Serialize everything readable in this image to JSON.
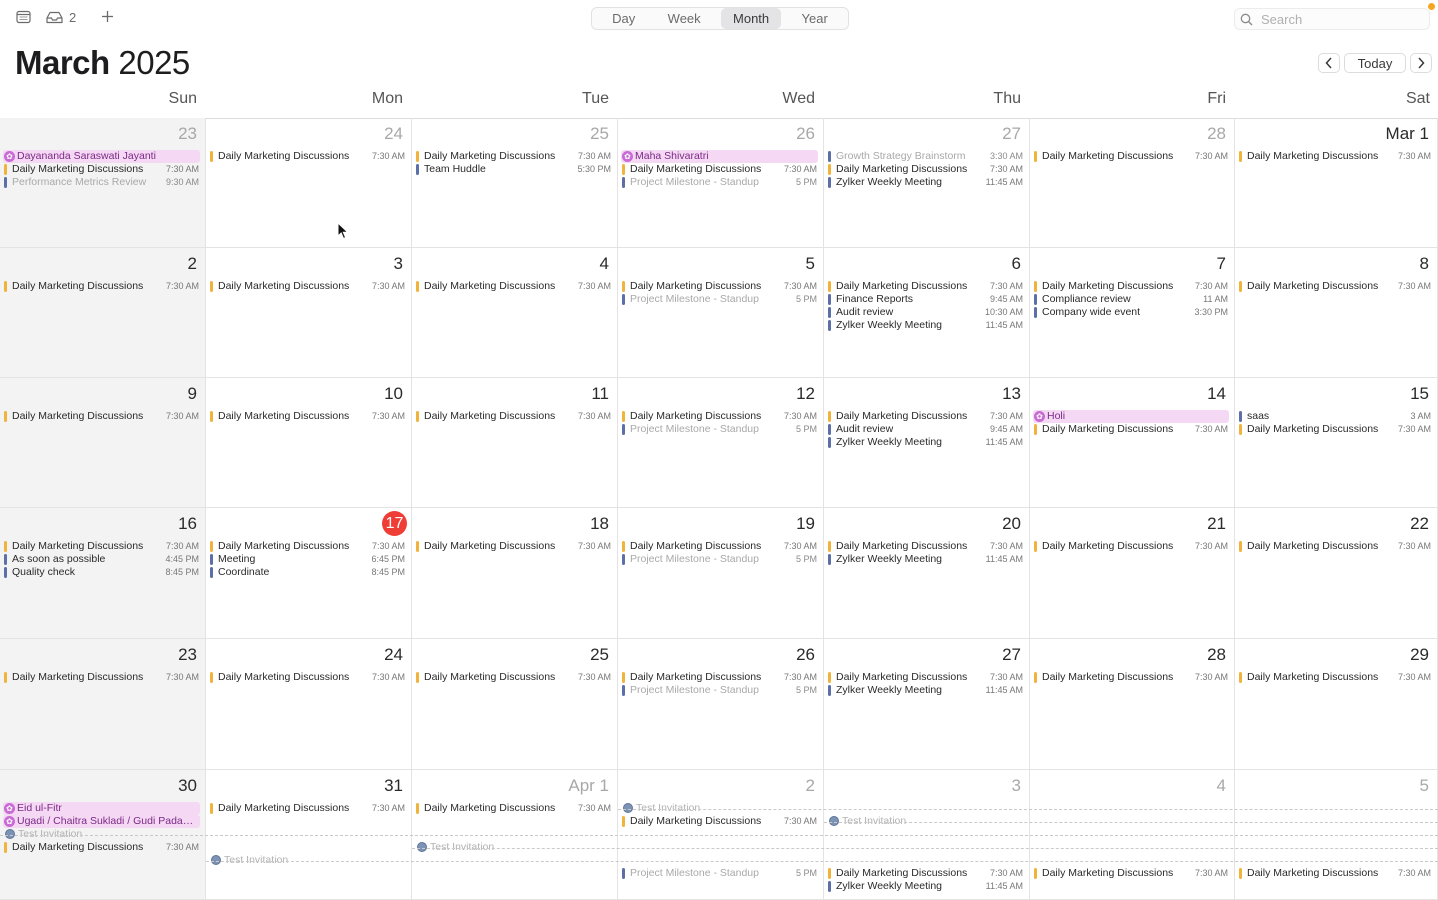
{
  "toolbar": {
    "inbox_count": "2",
    "views": [
      "Day",
      "Week",
      "Month",
      "Year"
    ],
    "active_view": "Month",
    "search_placeholder": "Search"
  },
  "header": {
    "month": "March",
    "year": "2025",
    "today_label": "Today"
  },
  "weekdays": [
    "Sun",
    "Mon",
    "Tue",
    "Wed",
    "Thu",
    "Fri",
    "Sat"
  ],
  "colors": {
    "work": "#f0b43c",
    "personal": "#5c6fa8",
    "holiday_bg": "#f5d8f3",
    "holiday_icon": "#c86bd4",
    "today": "#ef3e36"
  },
  "weeks": [
    [
      {
        "label": "23",
        "other": true,
        "events": [
          {
            "title": "Dayananda Saraswati Jayanti",
            "kind": "holiday"
          },
          {
            "title": "Daily Marketing Discussions",
            "time": "7:30 AM",
            "color": "work"
          },
          {
            "title": "Performance Metrics Review",
            "time": "9:30 AM",
            "color": "personal",
            "dim": true
          }
        ]
      },
      {
        "label": "24",
        "other": true,
        "events": [
          {
            "title": "Daily Marketing Discussions",
            "time": "7:30 AM",
            "color": "work"
          }
        ]
      },
      {
        "label": "25",
        "other": true,
        "events": [
          {
            "title": "Daily Marketing Discussions",
            "time": "7:30 AM",
            "color": "work"
          },
          {
            "title": "Team Huddle",
            "time": "5:30 PM",
            "color": "personal"
          }
        ]
      },
      {
        "label": "26",
        "other": true,
        "events": [
          {
            "title": "Maha Shivaratri",
            "kind": "holiday"
          },
          {
            "title": "Daily Marketing Discussions",
            "time": "7:30 AM",
            "color": "work"
          },
          {
            "title": "Project Milestone - Standup",
            "time": "5 PM",
            "color": "personal",
            "dim": true
          }
        ]
      },
      {
        "label": "27",
        "other": true,
        "events": [
          {
            "title": "Growth Strategy Brainstorm",
            "time": "3:30 AM",
            "color": "personal",
            "dim": true
          },
          {
            "title": "Daily Marketing Discussions",
            "time": "7:30 AM",
            "color": "work"
          },
          {
            "title": "Zylker Weekly Meeting",
            "time": "11:45 AM",
            "color": "personal"
          }
        ]
      },
      {
        "label": "28",
        "other": true,
        "events": [
          {
            "title": "Daily Marketing Discussions",
            "time": "7:30 AM",
            "color": "work"
          }
        ]
      },
      {
        "label": "Mar 1",
        "events": [
          {
            "title": "Daily Marketing Discussions",
            "time": "7:30 AM",
            "color": "work"
          }
        ]
      }
    ],
    [
      {
        "label": "2",
        "events": [
          {
            "title": "Daily Marketing Discussions",
            "time": "7:30 AM",
            "color": "work"
          }
        ]
      },
      {
        "label": "3",
        "events": [
          {
            "title": "Daily Marketing Discussions",
            "time": "7:30 AM",
            "color": "work"
          }
        ]
      },
      {
        "label": "4",
        "events": [
          {
            "title": "Daily Marketing Discussions",
            "time": "7:30 AM",
            "color": "work"
          }
        ]
      },
      {
        "label": "5",
        "events": [
          {
            "title": "Daily Marketing Discussions",
            "time": "7:30 AM",
            "color": "work"
          },
          {
            "title": "Project Milestone - Standup",
            "time": "5 PM",
            "color": "personal",
            "dim": true
          }
        ]
      },
      {
        "label": "6",
        "events": [
          {
            "title": "Daily Marketing Discussions",
            "time": "7:30 AM",
            "color": "work"
          },
          {
            "title": "Finance Reports",
            "time": "9:45 AM",
            "color": "personal"
          },
          {
            "title": "Audit review",
            "time": "10:30 AM",
            "color": "personal"
          },
          {
            "title": "Zylker Weekly Meeting",
            "time": "11:45 AM",
            "color": "personal"
          }
        ]
      },
      {
        "label": "7",
        "events": [
          {
            "title": "Daily Marketing Discussions",
            "time": "7:30 AM",
            "color": "work"
          },
          {
            "title": "Compliance review",
            "time": "11 AM",
            "color": "personal"
          },
          {
            "title": "Company wide event",
            "time": "3:30 PM",
            "color": "personal"
          }
        ]
      },
      {
        "label": "8",
        "events": [
          {
            "title": "Daily Marketing Discussions",
            "time": "7:30 AM",
            "color": "work"
          }
        ]
      }
    ],
    [
      {
        "label": "9",
        "events": [
          {
            "title": "Daily Marketing Discussions",
            "time": "7:30 AM",
            "color": "work"
          }
        ]
      },
      {
        "label": "10",
        "events": [
          {
            "title": "Daily Marketing Discussions",
            "time": "7:30 AM",
            "color": "work"
          }
        ]
      },
      {
        "label": "11",
        "events": [
          {
            "title": "Daily Marketing Discussions",
            "time": "7:30 AM",
            "color": "work"
          }
        ]
      },
      {
        "label": "12",
        "events": [
          {
            "title": "Daily Marketing Discussions",
            "time": "7:30 AM",
            "color": "work"
          },
          {
            "title": "Project Milestone - Standup",
            "time": "5 PM",
            "color": "personal",
            "dim": true
          }
        ]
      },
      {
        "label": "13",
        "events": [
          {
            "title": "Daily Marketing Discussions",
            "time": "7:30 AM",
            "color": "work"
          },
          {
            "title": "Audit review",
            "time": "9:45 AM",
            "color": "personal"
          },
          {
            "title": "Zylker Weekly Meeting",
            "time": "11:45 AM",
            "color": "personal"
          }
        ]
      },
      {
        "label": "14",
        "events": [
          {
            "title": "Holi",
            "kind": "holiday"
          },
          {
            "title": "Daily Marketing Discussions",
            "time": "7:30 AM",
            "color": "work"
          }
        ]
      },
      {
        "label": "15",
        "events": [
          {
            "title": "saas",
            "time": "3 AM",
            "color": "personal"
          },
          {
            "title": "Daily Marketing Discussions",
            "time": "7:30 AM",
            "color": "work"
          }
        ]
      }
    ],
    [
      {
        "label": "16",
        "events": [
          {
            "title": "Daily Marketing Discussions",
            "time": "7:30 AM",
            "color": "work"
          },
          {
            "title": "As soon as possible",
            "time": "4:45 PM",
            "color": "personal"
          },
          {
            "title": "Quality check",
            "time": "8:45 PM",
            "color": "personal"
          }
        ]
      },
      {
        "label": "17",
        "today": true,
        "events": [
          {
            "title": "Daily Marketing Discussions",
            "time": "7:30 AM",
            "color": "work"
          },
          {
            "title": "Meeting",
            "time": "6:45 PM",
            "color": "personal"
          },
          {
            "title": "Coordinate",
            "time": "8:45 PM",
            "color": "personal"
          }
        ]
      },
      {
        "label": "18",
        "events": [
          {
            "title": "Daily Marketing Discussions",
            "time": "7:30 AM",
            "color": "work"
          }
        ]
      },
      {
        "label": "19",
        "events": [
          {
            "title": "Daily Marketing Discussions",
            "time": "7:30 AM",
            "color": "work"
          },
          {
            "title": "Project Milestone - Standup",
            "time": "5 PM",
            "color": "personal",
            "dim": true
          }
        ]
      },
      {
        "label": "20",
        "events": [
          {
            "title": "Daily Marketing Discussions",
            "time": "7:30 AM",
            "color": "work"
          },
          {
            "title": "Zylker Weekly Meeting",
            "time": "11:45 AM",
            "color": "personal"
          }
        ]
      },
      {
        "label": "21",
        "events": [
          {
            "title": "Daily Marketing Discussions",
            "time": "7:30 AM",
            "color": "work"
          }
        ]
      },
      {
        "label": "22",
        "events": [
          {
            "title": "Daily Marketing Discussions",
            "time": "7:30 AM",
            "color": "work"
          }
        ]
      }
    ],
    [
      {
        "label": "23",
        "events": [
          {
            "title": "Daily Marketing Discussions",
            "time": "7:30 AM",
            "color": "work"
          }
        ]
      },
      {
        "label": "24",
        "events": [
          {
            "title": "Daily Marketing Discussions",
            "time": "7:30 AM",
            "color": "work"
          }
        ]
      },
      {
        "label": "25",
        "events": [
          {
            "title": "Daily Marketing Discussions",
            "time": "7:30 AM",
            "color": "work"
          }
        ]
      },
      {
        "label": "26",
        "events": [
          {
            "title": "Daily Marketing Discussions",
            "time": "7:30 AM",
            "color": "work"
          },
          {
            "title": "Project Milestone - Standup",
            "time": "5 PM",
            "color": "personal",
            "dim": true
          }
        ]
      },
      {
        "label": "27",
        "events": [
          {
            "title": "Daily Marketing Discussions",
            "time": "7:30 AM",
            "color": "work"
          },
          {
            "title": "Zylker Weekly Meeting",
            "time": "11:45 AM",
            "color": "personal"
          }
        ]
      },
      {
        "label": "28",
        "events": [
          {
            "title": "Daily Marketing Discussions",
            "time": "7:30 AM",
            "color": "work"
          }
        ]
      },
      {
        "label": "29",
        "events": [
          {
            "title": "Daily Marketing Discussions",
            "time": "7:30 AM",
            "color": "work"
          }
        ]
      }
    ],
    [
      {
        "label": "30",
        "events": [
          {
            "title": "Eid ul-Fitr",
            "kind": "holiday",
            "slot": 0
          },
          {
            "title": "Ugadi / Chaitra Sukladi / Gudi Pada…",
            "kind": "holiday",
            "slot": 1
          },
          {
            "title": "Test Invitation",
            "kind": "invite",
            "slot": 2
          },
          {
            "title": "Daily Marketing Discussions",
            "time": "7:30 AM",
            "color": "work",
            "slot": 3
          }
        ]
      },
      {
        "label": "31",
        "events": [
          {
            "title": "Daily Marketing Discussions",
            "time": "7:30 AM",
            "color": "work",
            "slot": 0
          },
          {
            "title": "Test Invitation",
            "kind": "invite",
            "slot": 4
          }
        ]
      },
      {
        "label": "Apr 1",
        "other": true,
        "events": [
          {
            "title": "Daily Marketing Discussions",
            "time": "7:30 AM",
            "color": "work",
            "slot": 0
          },
          {
            "title": "Test Invitation",
            "kind": "invite",
            "slot": 3
          }
        ]
      },
      {
        "label": "2",
        "other": true,
        "events": [
          {
            "title": "Test Invitation",
            "kind": "invite",
            "slot": 0
          },
          {
            "title": "Daily Marketing Discussions",
            "time": "7:30 AM",
            "color": "work",
            "slot": 1
          },
          {
            "title": "Project Milestone - Standup",
            "time": "5 PM",
            "color": "personal",
            "dim": true,
            "slot": 5
          }
        ]
      },
      {
        "label": "3",
        "other": true,
        "events": [
          {
            "title": "Test Invitation",
            "kind": "invite",
            "slot": 1
          },
          {
            "title": "Daily Marketing Discussions",
            "time": "7:30 AM",
            "color": "work",
            "slot": 5
          },
          {
            "title": "Zylker Weekly Meeting",
            "time": "11:45 AM",
            "color": "personal",
            "slot": 6
          }
        ]
      },
      {
        "label": "4",
        "other": true,
        "events": [
          {
            "title": "Daily Marketing Discussions",
            "time": "7:30 AM",
            "color": "work",
            "slot": 5
          }
        ]
      },
      {
        "label": "5",
        "other": true,
        "events": [
          {
            "title": "Daily Marketing Discussions",
            "time": "7:30 AM",
            "color": "work",
            "slot": 5
          }
        ]
      }
    ]
  ]
}
